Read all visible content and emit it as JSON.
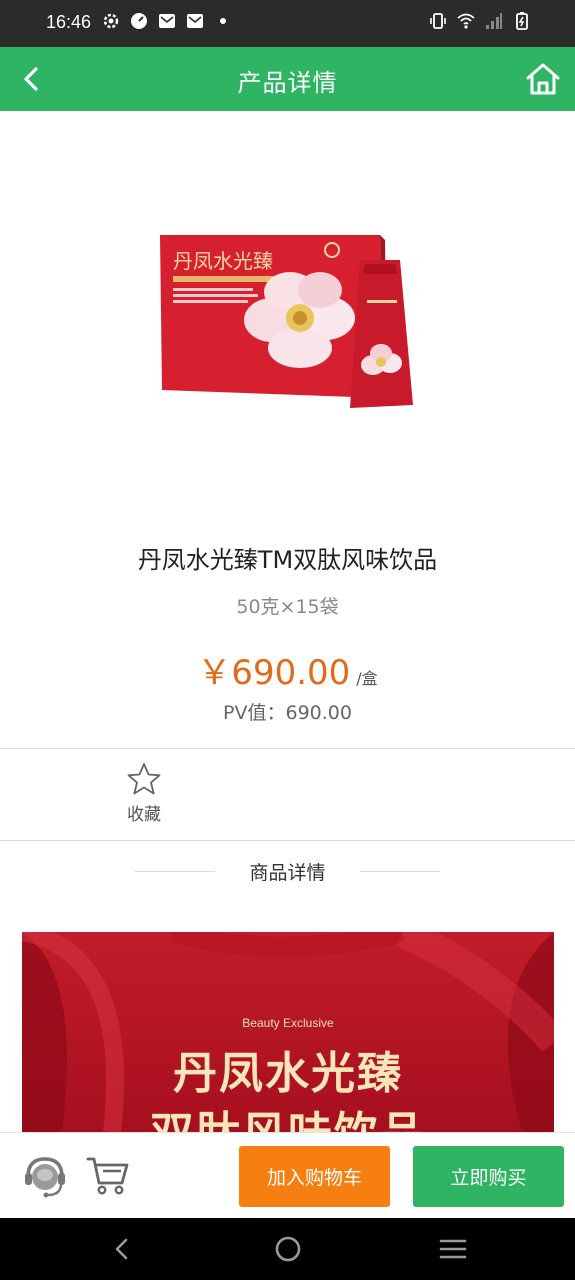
{
  "status_bar": {
    "time": "16:46"
  },
  "header": {
    "title": "产品详情"
  },
  "product": {
    "name": "丹凤水光臻TM双肽风味饮品",
    "spec": "50克×15袋",
    "price": "￥690.00",
    "price_unit": "/盒",
    "pv": "PV值：690.00",
    "image_text": {
      "brand": "丹凤水光臻"
    }
  },
  "favorite": {
    "label": "收藏"
  },
  "details": {
    "section_title": "商品详情",
    "banner": {
      "subtitle": "Beauty Exclusive",
      "line1": "丹凤水光臻",
      "line2": "双肽风味饮品"
    }
  },
  "actions": {
    "add_to_cart": "加入购物车",
    "buy_now": "立即购买"
  },
  "colors": {
    "brand_green": "#2fb463",
    "orange": "#f77e10",
    "price_orange": "#e26b1a",
    "product_red": "#d4202f"
  }
}
